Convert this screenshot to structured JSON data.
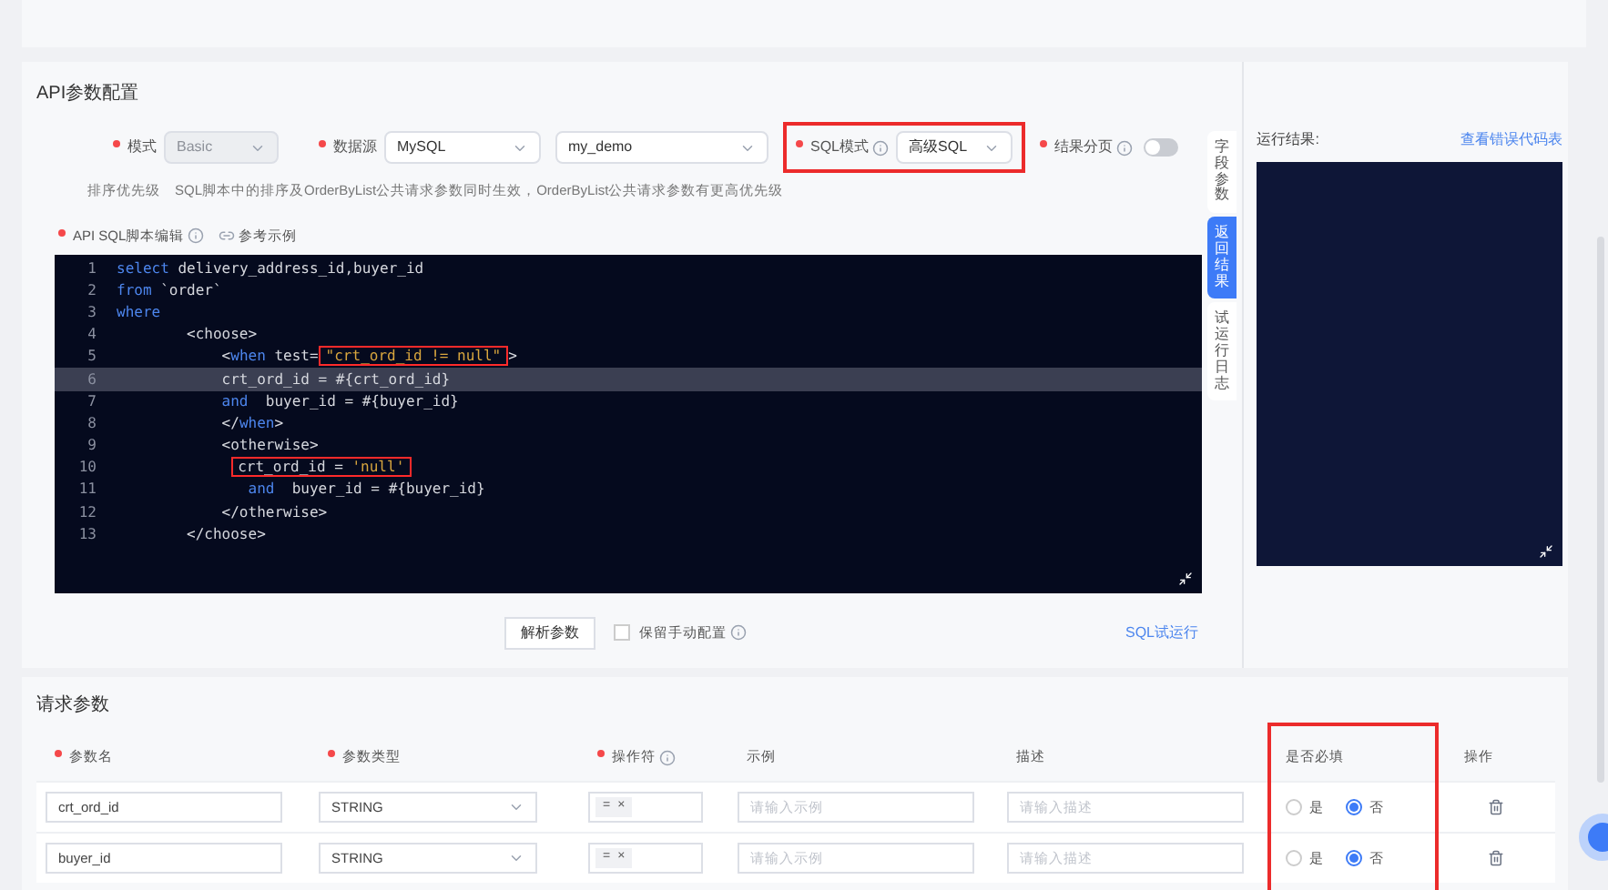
{
  "api_config": {
    "title": "API参数配置",
    "fields": [
      {
        "kind": "select",
        "label": "模式",
        "required": true,
        "info": false,
        "value": "Basic",
        "disabled": true,
        "highlighted": false
      },
      {
        "kind": "select",
        "label": "数据源",
        "required": true,
        "info": false,
        "value": "MySQL",
        "disabled": false,
        "highlighted": false
      },
      {
        "kind": "select",
        "value": "my_demo",
        "disabled": false,
        "highlighted": false
      },
      {
        "kind": "select",
        "label": "SQL模式",
        "required": true,
        "info": true,
        "value": "高级SQL",
        "disabled": false,
        "highlighted": true
      },
      {
        "kind": "switch",
        "label": "结果分页",
        "required": true,
        "info": true,
        "on": false
      }
    ],
    "note_label": "排序优先级",
    "note": "SQL脚本中的排序及OrderByList公共请求参数同时生效，OrderByList公共请求参数有更高优先级",
    "editor_label": "API SQL脚本编辑",
    "example_link": "参考示例",
    "code_lines": [
      {
        "number": "1",
        "current": false,
        "tokens": [
          {
            "kind": "keyword",
            "text": "select"
          },
          {
            "kind": "plain",
            "text": " delivery_address_id,buyer_id"
          }
        ]
      },
      {
        "number": "2",
        "current": false,
        "tokens": [
          {
            "kind": "keyword",
            "text": "from"
          },
          {
            "kind": "plain",
            "text": " `order`"
          }
        ]
      },
      {
        "number": "3",
        "current": false,
        "tokens": [
          {
            "kind": "keyword",
            "text": "where"
          }
        ]
      },
      {
        "number": "4",
        "current": false,
        "tokens": [
          {
            "kind": "plain",
            "text": "        <choose>"
          }
        ]
      },
      {
        "number": "5",
        "current": false,
        "tokens": [
          {
            "kind": "plain",
            "text": "            <"
          },
          {
            "kind": "keyword",
            "text": "when"
          },
          {
            "kind": "plain",
            "text": " test="
          },
          {
            "kind": "box",
            "tokens": [
              {
                "kind": "string",
                "text": "\"crt_ord_id != null\""
              }
            ]
          },
          {
            "kind": "plain",
            "text": ">"
          }
        ]
      },
      {
        "number": "6",
        "current": true,
        "tokens": [
          {
            "kind": "plain",
            "text": "            crt_ord_id = #{crt_ord_id}"
          }
        ]
      },
      {
        "number": "7",
        "current": false,
        "tokens": [
          {
            "kind": "keyword",
            "text": "            and"
          },
          {
            "kind": "plain",
            "text": "  buyer_id = #{buyer_id}"
          }
        ]
      },
      {
        "number": "8",
        "current": false,
        "tokens": [
          {
            "kind": "plain",
            "text": "            </"
          },
          {
            "kind": "keyword",
            "text": "when"
          },
          {
            "kind": "plain",
            "text": ">"
          }
        ]
      },
      {
        "number": "9",
        "current": false,
        "tokens": [
          {
            "kind": "plain",
            "text": "            <otherwise>"
          }
        ]
      },
      {
        "number": "10",
        "current": false,
        "tokens": [
          {
            "kind": "box",
            "tokens": [
              {
                "kind": "plain",
                "text": "crt_ord_id = "
              },
              {
                "kind": "string",
                "text": "'null'"
              }
            ]
          }
        ]
      },
      {
        "number": "11",
        "current": false,
        "tokens": [
          {
            "kind": "keyword",
            "text": "               and"
          },
          {
            "kind": "plain",
            "text": "  buyer_id = #{buyer_id}"
          }
        ]
      },
      {
        "number": "12",
        "current": false,
        "tokens": [
          {
            "kind": "plain",
            "text": "            </otherwise>"
          }
        ]
      },
      {
        "number": "13",
        "current": false,
        "tokens": [
          {
            "kind": "plain",
            "text": "        </choose>"
          }
        ]
      }
    ],
    "parse_button": "解析参数",
    "keep_manual": {
      "label": "保留手动配置",
      "checked": false
    },
    "run_link": "SQL试运行"
  },
  "side_tabs": [
    {
      "label": "字段参数",
      "selected": false
    },
    {
      "label": "返回结果",
      "selected": true
    },
    {
      "label": "试运行日志",
      "selected": false
    }
  ],
  "result": {
    "label": "运行结果:",
    "link": "查看错误代码表"
  },
  "request_params": {
    "title": "请求参数",
    "columns": [
      {
        "label": "参数名",
        "required": true,
        "info": false,
        "highlighted": false
      },
      {
        "label": "参数类型",
        "required": true,
        "info": false,
        "highlighted": false
      },
      {
        "label": "操作符",
        "required": true,
        "info": true,
        "highlighted": false
      },
      {
        "label": "示例",
        "required": false,
        "info": false,
        "highlighted": false
      },
      {
        "label": "描述",
        "required": false,
        "info": false,
        "highlighted": false
      },
      {
        "label": "是否必填",
        "required": false,
        "info": false,
        "highlighted": true
      },
      {
        "label": "操作",
        "required": false,
        "info": false,
        "highlighted": false
      }
    ],
    "rows": [
      {
        "name": "crt_ord_id",
        "type": "STRING",
        "operator": "=",
        "operator_remove": "×",
        "example_placeholder": "请输入示例",
        "description_placeholder": "请输入描述",
        "options": [
          {
            "label": "是",
            "selected": false
          },
          {
            "label": "否",
            "selected": true
          }
        ]
      },
      {
        "name": "buyer_id",
        "type": "STRING",
        "operator": "=",
        "operator_remove": "×",
        "example_placeholder": "请输入示例",
        "description_placeholder": "请输入描述",
        "options": [
          {
            "label": "是",
            "selected": false
          },
          {
            "label": "否",
            "selected": true
          }
        ]
      }
    ]
  }
}
